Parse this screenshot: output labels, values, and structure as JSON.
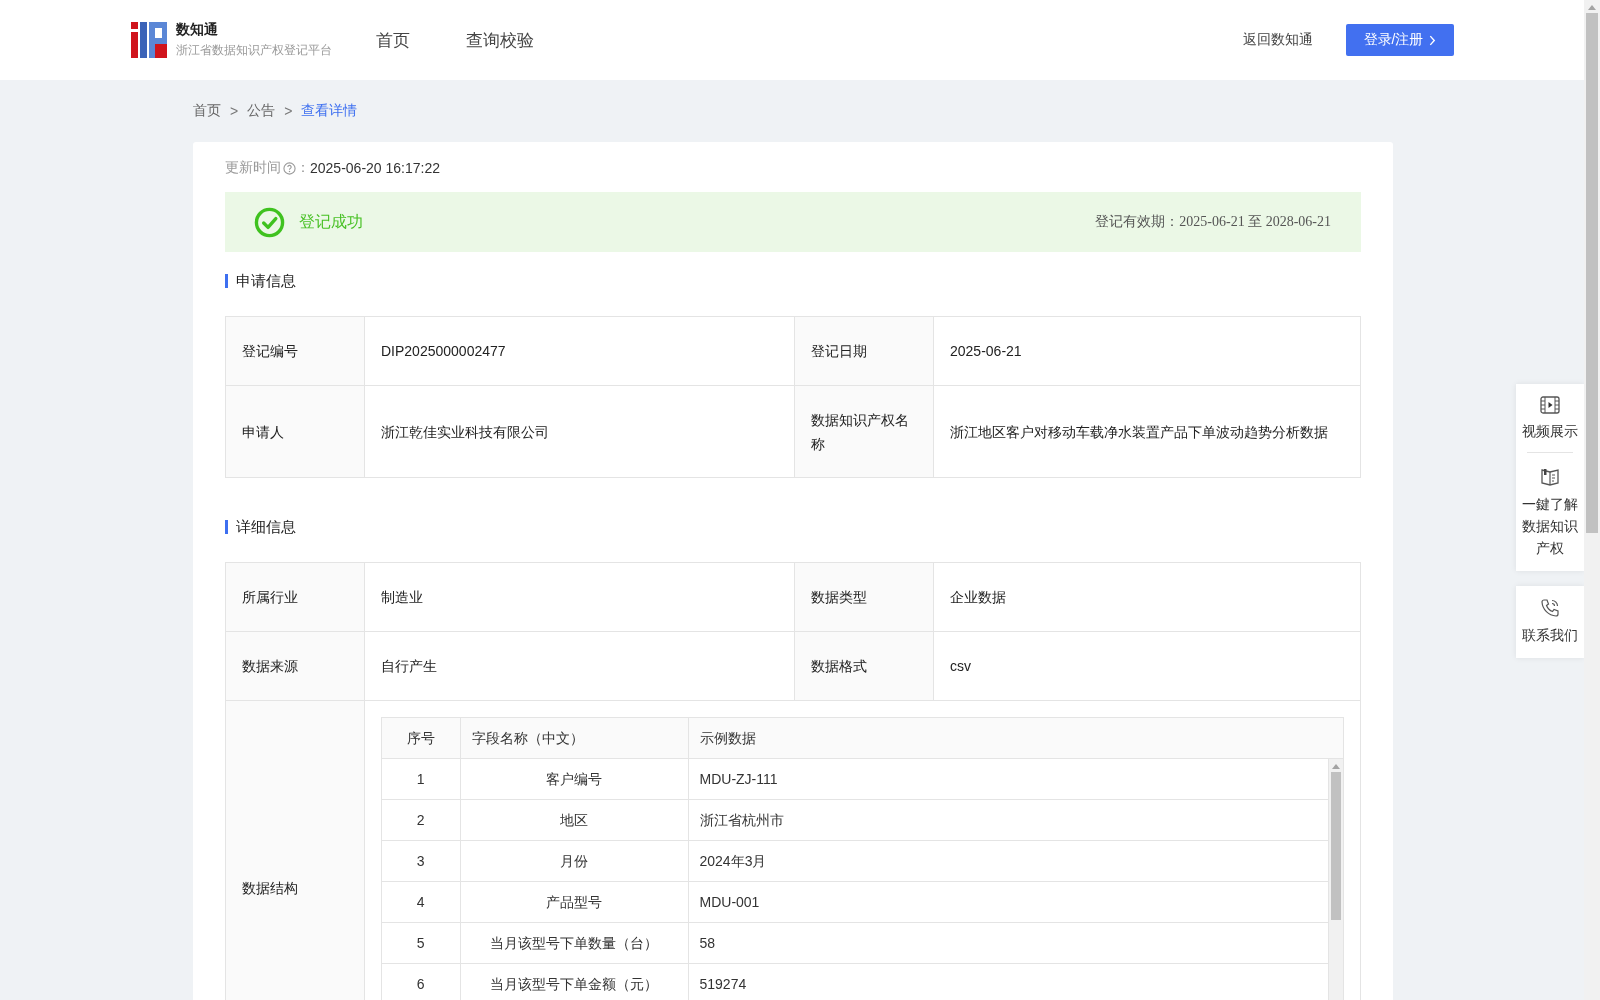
{
  "header": {
    "logo_title": "数知通",
    "logo_subtitle": "浙江省数据知识产权登记平台",
    "nav": [
      "首页",
      "查询校验"
    ],
    "back_link": "返回数知通",
    "login_button": "登录/注册"
  },
  "breadcrumb": {
    "items": [
      "首页",
      "公告",
      "查看详情"
    ],
    "separator": ">"
  },
  "update_time": {
    "label": "更新时间",
    "colon": "：",
    "value": "2025-06-20 16:17:22"
  },
  "status_banner": {
    "text": "登记成功",
    "validity_label": "登记有效期：",
    "validity_value": "2025-06-21 至 2028-06-21"
  },
  "application_info": {
    "title": "申请信息",
    "rows": [
      [
        {
          "label": "登记编号",
          "value": "DIP2025000002477"
        },
        {
          "label": "登记日期",
          "value": "2025-06-21"
        }
      ],
      [
        {
          "label": "申请人",
          "value": "浙江乾佳实业科技有限公司"
        },
        {
          "label": "数据知识产权名称",
          "value": "浙江地区客户对移动车载净水装置产品下单波动趋势分析数据"
        }
      ]
    ]
  },
  "detail_info": {
    "title": "详细信息",
    "rows": [
      [
        {
          "label": "所属行业",
          "value": "制造业"
        },
        {
          "label": "数据类型",
          "value": "企业数据"
        }
      ],
      [
        {
          "label": "数据来源",
          "value": "自行产生"
        },
        {
          "label": "数据格式",
          "value": "csv"
        }
      ]
    ],
    "structure": {
      "label": "数据结构",
      "columns": [
        "序号",
        "字段名称（中文）",
        "示例数据"
      ],
      "rows": [
        [
          "1",
          "客户编号",
          "MDU-ZJ-111"
        ],
        [
          "2",
          "地区",
          "浙江省杭州市"
        ],
        [
          "3",
          "月份",
          "2024年3月"
        ],
        [
          "4",
          "产品型号",
          "MDU-001"
        ],
        [
          "5",
          "当月该型号下单数量（台）",
          "58"
        ],
        [
          "6",
          "当月该型号下单金额（元）",
          "519274"
        ]
      ]
    }
  },
  "side_panel": {
    "items": [
      {
        "kind": "video",
        "label": "视频展示"
      },
      {
        "kind": "book",
        "label": "一鍵了解数据知识产权"
      }
    ],
    "contact": {
      "kind": "phone",
      "label": "联系我们"
    }
  }
}
